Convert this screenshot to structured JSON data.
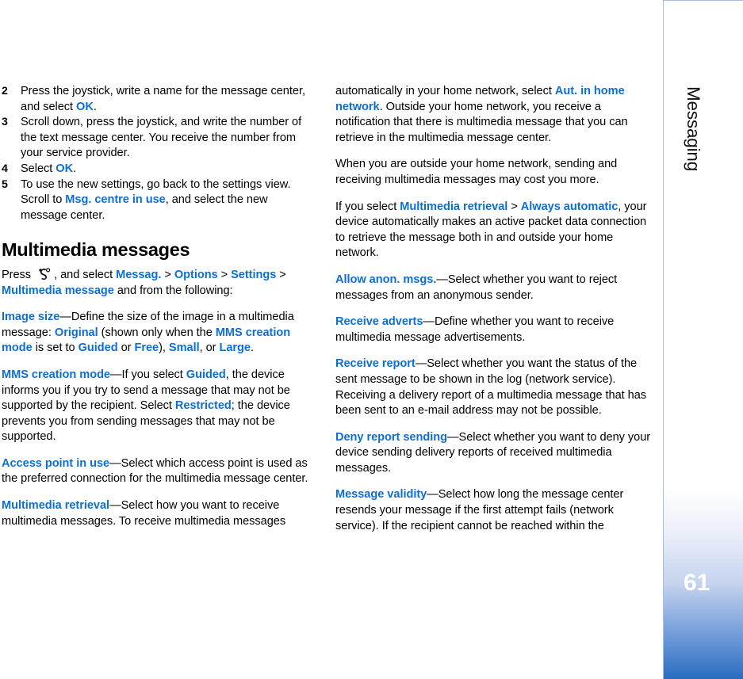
{
  "sidebar": {
    "chapter_title": "Messaging",
    "page_number": "61",
    "accent_color": "#2a6cc0",
    "border_color": "#a8bde4"
  },
  "theme": {
    "ui_term_color": "#0d6fd6",
    "body_text_color": "#000000",
    "background": "#ffffff"
  },
  "left_column": {
    "steps": [
      {
        "number": "2",
        "segments": [
          {
            "text": "Press the joystick, write a name for the message center, and select ",
            "style": "plain"
          },
          {
            "text": "OK",
            "style": "ui"
          },
          {
            "text": ".",
            "style": "plain"
          }
        ]
      },
      {
        "number": "3",
        "segments": [
          {
            "text": "Scroll down, press the joystick, and write the number of the text message center. You receive the number from your service provider.",
            "style": "plain"
          }
        ]
      },
      {
        "number": "4",
        "segments": [
          {
            "text": "Select ",
            "style": "plain"
          },
          {
            "text": "OK",
            "style": "ui"
          },
          {
            "text": ".",
            "style": "plain"
          }
        ]
      },
      {
        "number": "5",
        "segments": [
          {
            "text": "To use the new settings, go back to the settings view. Scroll to ",
            "style": "plain"
          },
          {
            "text": "Msg. centre in use",
            "style": "ui"
          },
          {
            "text": ", and select the new message center.",
            "style": "plain"
          }
        ]
      }
    ],
    "heading": "Multimedia messages",
    "paragraphs": [
      {
        "id": "press-menu",
        "segments": [
          {
            "text": "Press ",
            "style": "plain"
          },
          {
            "text": "menu-key-icon",
            "style": "icon"
          },
          {
            "text": ", and select ",
            "style": "plain"
          },
          {
            "text": "Messag.",
            "style": "ui"
          },
          {
            "text": " > ",
            "style": "sep"
          },
          {
            "text": "Options",
            "style": "ui"
          },
          {
            "text": " > ",
            "style": "sep"
          },
          {
            "text": "Settings",
            "style": "ui"
          },
          {
            "text": " > ",
            "style": "sep"
          },
          {
            "text": "Multimedia message",
            "style": "ui"
          },
          {
            "text": " and from the following:",
            "style": "plain"
          }
        ]
      },
      {
        "id": "image-size",
        "segments": [
          {
            "text": "Image size",
            "style": "ui"
          },
          {
            "text": "—Define the size of the image in a multimedia message: ",
            "style": "plain"
          },
          {
            "text": "Original",
            "style": "ui"
          },
          {
            "text": " (shown only when the ",
            "style": "plain"
          },
          {
            "text": "MMS creation mode",
            "style": "ui"
          },
          {
            "text": " is set to ",
            "style": "plain"
          },
          {
            "text": "Guided",
            "style": "ui"
          },
          {
            "text": " or ",
            "style": "plain"
          },
          {
            "text": "Free",
            "style": "ui"
          },
          {
            "text": "), ",
            "style": "plain"
          },
          {
            "text": "Small",
            "style": "ui"
          },
          {
            "text": ", or ",
            "style": "plain"
          },
          {
            "text": "Large",
            "style": "ui"
          },
          {
            "text": ".",
            "style": "plain"
          }
        ]
      },
      {
        "id": "mms-creation-mode",
        "segments": [
          {
            "text": "MMS creation mode",
            "style": "ui"
          },
          {
            "text": "—If you select ",
            "style": "plain"
          },
          {
            "text": "Guided",
            "style": "ui"
          },
          {
            "text": ", the device informs you if you try to send a message that may not be supported by the recipient. Select ",
            "style": "plain"
          },
          {
            "text": "Restricted",
            "style": "ui"
          },
          {
            "text": "; the device prevents you from sending messages that may not be supported.",
            "style": "plain"
          }
        ]
      },
      {
        "id": "access-point-in-use",
        "segments": [
          {
            "text": "Access point in use",
            "style": "ui"
          },
          {
            "text": "—Select which access point is used as the preferred connection for the multimedia message center.",
            "style": "plain"
          }
        ]
      },
      {
        "id": "multimedia-retrieval",
        "segments": [
          {
            "text": "Multimedia retrieval",
            "style": "ui"
          },
          {
            "text": "—Select how you want to receive multimedia messages. To receive multimedia messages",
            "style": "plain"
          }
        ]
      }
    ]
  },
  "right_column": {
    "paragraphs": [
      {
        "id": "aut-in-home-network",
        "segments": [
          {
            "text": "automatically in your home network, select ",
            "style": "plain"
          },
          {
            "text": "Aut. in home network",
            "style": "ui"
          },
          {
            "text": ". Outside your home network, you receive a notification that there is multimedia message that you can retrieve in the multimedia message center.",
            "style": "plain"
          }
        ]
      },
      {
        "id": "outside-home-network-cost",
        "segments": [
          {
            "text": "When you are outside your home network, sending and receiving multimedia messages may cost you more.",
            "style": "plain"
          }
        ]
      },
      {
        "id": "always-automatic",
        "segments": [
          {
            "text": "If you select ",
            "style": "plain"
          },
          {
            "text": "Multimedia retrieval",
            "style": "ui"
          },
          {
            "text": " > ",
            "style": "sep"
          },
          {
            "text": "Always automatic",
            "style": "ui"
          },
          {
            "text": ", your device automatically makes an active packet data connection to retrieve the message both in and outside your home network.",
            "style": "plain"
          }
        ]
      },
      {
        "id": "allow-anon-msgs",
        "segments": [
          {
            "text": "Allow anon. msgs.",
            "style": "ui"
          },
          {
            "text": "—Select whether you want to reject messages from an anonymous sender.",
            "style": "plain"
          }
        ]
      },
      {
        "id": "receive-adverts",
        "segments": [
          {
            "text": "Receive adverts",
            "style": "ui"
          },
          {
            "text": "—Define whether you want to receive multimedia message advertisements.",
            "style": "plain"
          }
        ]
      },
      {
        "id": "receive-report",
        "segments": [
          {
            "text": "Receive report",
            "style": "ui"
          },
          {
            "text": "—Select whether you want the status of the sent message to be shown in the log (network service). Receiving a delivery report of a multimedia message that has been sent to an e-mail address may not be possible.",
            "style": "plain"
          }
        ]
      },
      {
        "id": "deny-report-sending",
        "segments": [
          {
            "text": "Deny report sending",
            "style": "ui"
          },
          {
            "text": "—Select whether you want to deny your device sending delivery reports of received multimedia messages.",
            "style": "plain"
          }
        ]
      },
      {
        "id": "message-validity",
        "segments": [
          {
            "text": "Message validity",
            "style": "ui"
          },
          {
            "text": "—Select how long the message center resends your message if the first attempt fails (network service). If the recipient cannot be reached within the",
            "style": "plain"
          }
        ]
      }
    ]
  }
}
